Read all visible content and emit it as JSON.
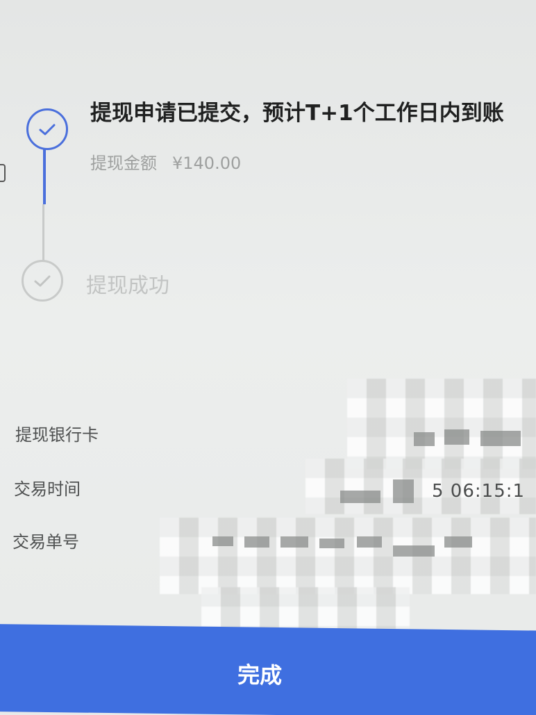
{
  "steps": [
    {
      "title": "提现申请已提交，预计T+1个工作日内到账",
      "amount_label": "提现金额",
      "amount_value": "¥140.00",
      "status": "active"
    },
    {
      "title": "提现成功",
      "status": "inactive"
    }
  ],
  "details": {
    "bank_card_label": "提现银行卡",
    "time_label": "交易时间",
    "time_value_visible": "5 06:15:1",
    "order_label": "交易单号"
  },
  "done_button": {
    "label": "完成"
  },
  "colors": {
    "accent": "#4a6fdc",
    "button": "#3f6fe0",
    "inactive": "#c8cac9",
    "background": "#e9ebea"
  },
  "icons": {
    "step_check": "check-icon"
  }
}
